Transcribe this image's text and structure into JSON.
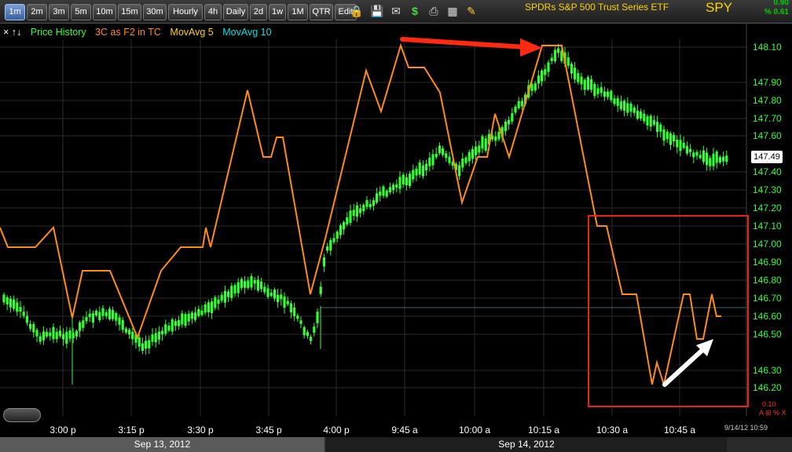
{
  "toolbar": {
    "timeframes": [
      "1m",
      "2m",
      "3m",
      "5m",
      "10m",
      "15m",
      "30m",
      "Hourly",
      "4h",
      "Daily",
      "2d",
      "1w",
      "1M",
      "QTR",
      "Edit"
    ],
    "active_timeframe": "1m",
    "icons": [
      "lock-icon",
      "save-icon",
      "mail-icon",
      "dollar-icon",
      "print-icon",
      "table-icon",
      "pencil-icon"
    ]
  },
  "ticker": {
    "name": "SPDRs S&P 500 Trust Series ETF",
    "symbol": "SPY",
    "change_abs": "0.90",
    "change_pct": "% 0.61"
  },
  "legend": {
    "arrows": "× ↑↓",
    "items": [
      {
        "label": "Price History",
        "color": "#33ff33"
      },
      {
        "label": "3C as F2 in TC",
        "color": "#ff8c1a"
      },
      {
        "label": "MovAvg 5",
        "color": "#ffd400"
      },
      {
        "label": "MovAvg 10",
        "color": "#00e0e0"
      }
    ]
  },
  "price_axis": {
    "labels": [
      "148.10",
      "147.90",
      "147.80",
      "147.70",
      "147.60",
      "147.40",
      "147.30",
      "147.20",
      "147.10",
      "147.00",
      "146.90",
      "146.80",
      "146.70",
      "146.60",
      "146.50",
      "146.30",
      "146.20"
    ],
    "current_price": "147.49"
  },
  "time_axis": {
    "labels": [
      "3:00 p",
      "3:15 p",
      "3:30 p",
      "3:45 p",
      "4:00 p",
      "9:45 a",
      "10:00 a",
      "10:15 a",
      "10:30 a",
      "10:45 a"
    ]
  },
  "dates": {
    "left": "Sep 13, 2012",
    "right": "Sep 14, 2012"
  },
  "timestamp": "9/14/12 10:59",
  "lower_indicator": {
    "value": "0.10",
    "controls": "A ⊞ % X"
  },
  "colors": {
    "candle": "#33ff33",
    "indicator": "#ff8c1a",
    "grid": "#2b2b2b",
    "axis_text": "#33ff33",
    "annotation_red": "#ff2a10",
    "annotation_box": "#e8231b",
    "annotation_white": "#ffffff",
    "prev_close_line": "#2a6e70"
  }
}
